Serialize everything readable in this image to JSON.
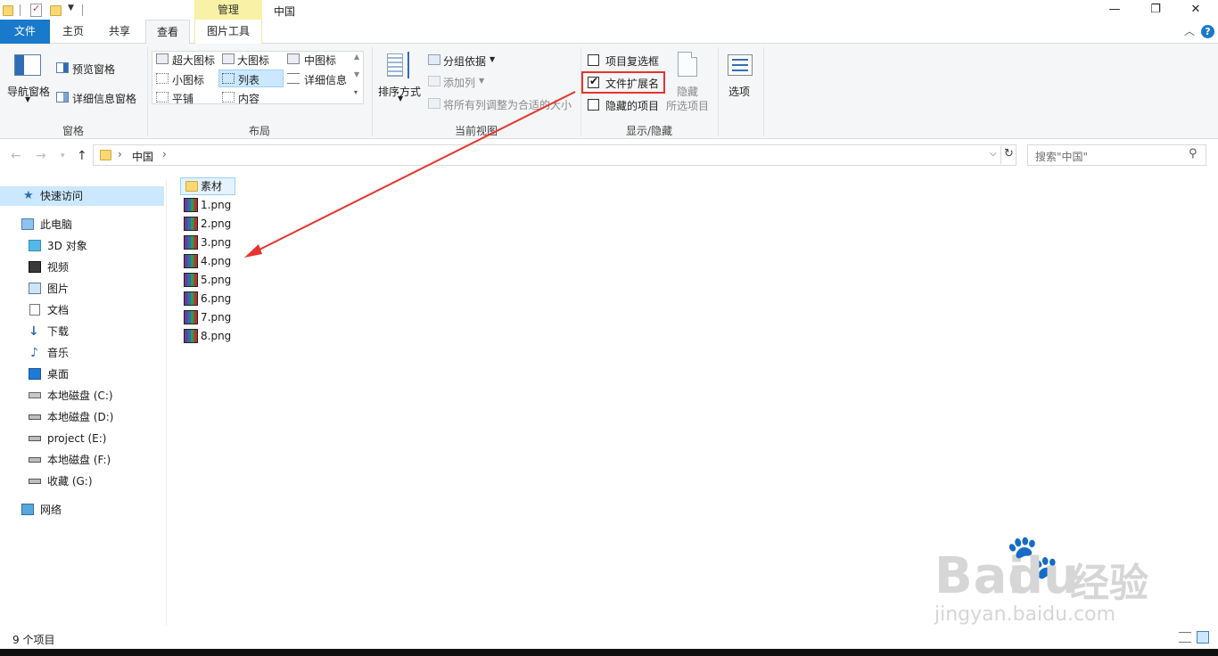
{
  "titlebar": {
    "manage_tab": "管理",
    "title": "中国",
    "minimize_glyph": "—",
    "restore_glyph": "❐",
    "close_glyph": "✕"
  },
  "tabs": {
    "file": "文件",
    "home": "主页",
    "share": "共享",
    "view": "查看",
    "picture_tools": "图片工具"
  },
  "help_glyph": "?",
  "collapse_glyph": "︿",
  "ribbon": {
    "panes": {
      "label": "窗格",
      "nav_pane": "导航窗格",
      "preview_pane": "预览窗格",
      "details_pane": "详细信息窗格"
    },
    "layout": {
      "label": "布局",
      "extra_large": "超大图标",
      "large": "大图标",
      "medium": "中图标",
      "small": "小图标",
      "list": "列表",
      "details": "详细信息",
      "tiles": "平铺",
      "content": "内容"
    },
    "current_view": {
      "label": "当前视图",
      "sort_by": "排序方式",
      "group_by": "分组依据",
      "add_columns": "添加列",
      "size_all_columns": "将所有列调整为合适的大小"
    },
    "show_hide": {
      "label": "显示/隐藏",
      "item_checkboxes": "项目复选框",
      "item_checkboxes_checked": false,
      "file_extensions": "文件扩展名",
      "file_extensions_checked": true,
      "hidden_items": "隐藏的项目",
      "hidden_items_checked": false,
      "hide_selected_line1": "隐藏",
      "hide_selected_line2": "所选项目"
    },
    "options": "选项"
  },
  "address": {
    "crumb": "中国",
    "search_placeholder": "搜索\"中国\""
  },
  "nav": {
    "quick_access": "快速访问",
    "this_pc": "此电脑",
    "items": [
      "3D 对象",
      "视频",
      "图片",
      "文档",
      "下载",
      "音乐",
      "桌面",
      "本地磁盘 (C:)",
      "本地磁盘 (D:)",
      "project (E:)",
      "本地磁盘 (F:)",
      "收藏 (G:)"
    ],
    "network": "网络"
  },
  "files": [
    "素材",
    "1.png",
    "2.png",
    "3.png",
    "4.png",
    "5.png",
    "6.png",
    "7.png",
    "8.png"
  ],
  "status": {
    "count": "9 个项目"
  },
  "watermark": {
    "brand": "Bai",
    "brand2": "du",
    "jingyan": "经验",
    "url": "jingyan.baidu.com"
  },
  "colors": {
    "file_tab": "#1979ca",
    "manage_tab": "#f9f1a5",
    "selection": "#cce8ff",
    "highlight_box": "#e8342c"
  }
}
